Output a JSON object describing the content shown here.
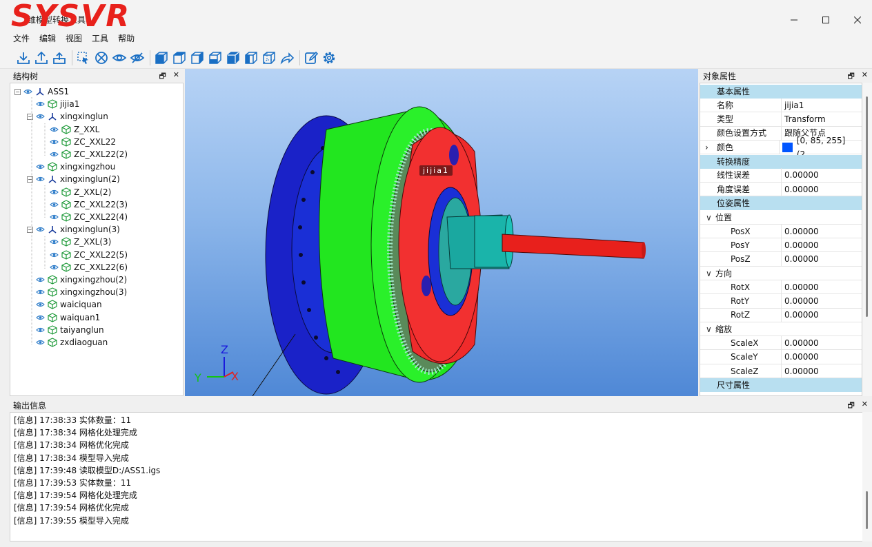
{
  "window": {
    "logo": "SYSVR",
    "title": "维模型转换工具",
    "controls": {
      "minimize": "minimize-icon",
      "maximize": "maximize-icon",
      "close": "close-icon"
    }
  },
  "menu": [
    "文件",
    "编辑",
    "视图",
    "工具",
    "帮助"
  ],
  "toolbar": [
    "import-icon",
    "export-icon",
    "upload-icon",
    "sep",
    "select-icon",
    "hide-all-icon",
    "show-icon",
    "hide-icon",
    "sep",
    "view-iso-icon",
    "view-front-icon",
    "view-back-icon",
    "view-left-icon",
    "view-right-icon",
    "view-top-icon",
    "view-wireframe-icon",
    "view-redo-icon",
    "sep",
    "edit-icon",
    "settings-icon"
  ],
  "tree_panel": {
    "title": "结构树",
    "items": [
      {
        "label": "ASS1",
        "type": "assembly",
        "level": 0,
        "expand": "minus"
      },
      {
        "label": "jijia1",
        "type": "part",
        "level": 1,
        "expand": ""
      },
      {
        "label": "xingxinglun",
        "type": "assembly",
        "level": 1,
        "expand": "minus"
      },
      {
        "label": "Z_XXL",
        "type": "part",
        "level": 2,
        "expand": ""
      },
      {
        "label": "ZC_XXL22",
        "type": "part",
        "level": 2,
        "expand": ""
      },
      {
        "label": "ZC_XXL22(2)",
        "type": "part",
        "level": 2,
        "expand": ""
      },
      {
        "label": "xingxingzhou",
        "type": "part",
        "level": 1,
        "expand": ""
      },
      {
        "label": "xingxinglun(2)",
        "type": "assembly",
        "level": 1,
        "expand": "minus"
      },
      {
        "label": "Z_XXL(2)",
        "type": "part",
        "level": 2,
        "expand": ""
      },
      {
        "label": "ZC_XXL22(3)",
        "type": "part",
        "level": 2,
        "expand": ""
      },
      {
        "label": "ZC_XXL22(4)",
        "type": "part",
        "level": 2,
        "expand": ""
      },
      {
        "label": "xingxinglun(3)",
        "type": "assembly",
        "level": 1,
        "expand": "minus"
      },
      {
        "label": "Z_XXL(3)",
        "type": "part",
        "level": 2,
        "expand": ""
      },
      {
        "label": "ZC_XXL22(5)",
        "type": "part",
        "level": 2,
        "expand": ""
      },
      {
        "label": "ZC_XXL22(6)",
        "type": "part",
        "level": 2,
        "expand": ""
      },
      {
        "label": "xingxingzhou(2)",
        "type": "part",
        "level": 1,
        "expand": ""
      },
      {
        "label": "xingxingzhou(3)",
        "type": "part",
        "level": 1,
        "expand": ""
      },
      {
        "label": "waiciquan",
        "type": "part",
        "level": 1,
        "expand": ""
      },
      {
        "label": "waiquan1",
        "type": "part",
        "level": 1,
        "expand": ""
      },
      {
        "label": "taiyanglun",
        "type": "part",
        "level": 1,
        "expand": ""
      },
      {
        "label": "zxdiaoguan",
        "type": "part",
        "level": 1,
        "expand": ""
      }
    ]
  },
  "viewport": {
    "hover_label": "jijia1",
    "axis_labels": {
      "z": "Z",
      "y": "Y",
      "x": "X"
    },
    "colors": {
      "flange": "#1a2fd6",
      "housing": "#22e61f",
      "carrier": "#ef2b2b",
      "shaft": "#1aa8a0",
      "output_shaft": "#e8201c"
    }
  },
  "props_panel": {
    "title": "对象属性",
    "rows": [
      {
        "kind": "group",
        "label": "基本属性"
      },
      {
        "kind": "row",
        "key": "名称",
        "value": "jijia1",
        "indent": 1
      },
      {
        "kind": "row",
        "key": "类型",
        "value": "Transform",
        "indent": 1
      },
      {
        "kind": "row",
        "key": "颜色设置方式",
        "value": "跟随父节点",
        "indent": 1
      },
      {
        "kind": "color",
        "key": "颜色",
        "value": "[0, 85, 255] (2...",
        "color": "#0055ff",
        "indent": 1
      },
      {
        "kind": "group",
        "label": "转换精度"
      },
      {
        "kind": "row",
        "key": "线性误差",
        "value": "0.00000",
        "indent": 1
      },
      {
        "kind": "row",
        "key": "角度误差",
        "value": "0.00000",
        "indent": 1
      },
      {
        "kind": "group",
        "label": "位姿属性"
      },
      {
        "kind": "sub",
        "label": "位置"
      },
      {
        "kind": "row",
        "key": "PosX",
        "value": "0.00000",
        "indent": 2
      },
      {
        "kind": "row",
        "key": "PosY",
        "value": "0.00000",
        "indent": 2
      },
      {
        "kind": "row",
        "key": "PosZ",
        "value": "0.00000",
        "indent": 2
      },
      {
        "kind": "sub",
        "label": "方向"
      },
      {
        "kind": "row",
        "key": "RotX",
        "value": "0.00000",
        "indent": 2
      },
      {
        "kind": "row",
        "key": "RotY",
        "value": "0.00000",
        "indent": 2
      },
      {
        "kind": "row",
        "key": "RotZ",
        "value": "0.00000",
        "indent": 2
      },
      {
        "kind": "sub",
        "label": "缩放"
      },
      {
        "kind": "row",
        "key": "ScaleX",
        "value": "0.00000",
        "indent": 2
      },
      {
        "kind": "row",
        "key": "ScaleY",
        "value": "0.00000",
        "indent": 2
      },
      {
        "kind": "row",
        "key": "ScaleZ",
        "value": "0.00000",
        "indent": 2
      },
      {
        "kind": "group",
        "label": "尺寸属性"
      }
    ]
  },
  "output_panel": {
    "title": "输出信息",
    "lines": [
      "[信息] 17:38:33 实体数量：11",
      "[信息] 17:38:34 网格化处理完成",
      "[信息] 17:38:34 网格优化完成",
      "[信息] 17:38:34 模型导入完成",
      "[信息] 17:39:48 读取模型D:/ASS1.igs",
      "[信息] 17:39:53 实体数量：11",
      "[信息] 17:39:54 网格化处理完成",
      "[信息] 17:39:54 网格优化完成",
      "[信息] 17:39:55 模型导入完成"
    ]
  },
  "dock_buttons": {
    "float": "float-icon",
    "close": "close-icon"
  }
}
